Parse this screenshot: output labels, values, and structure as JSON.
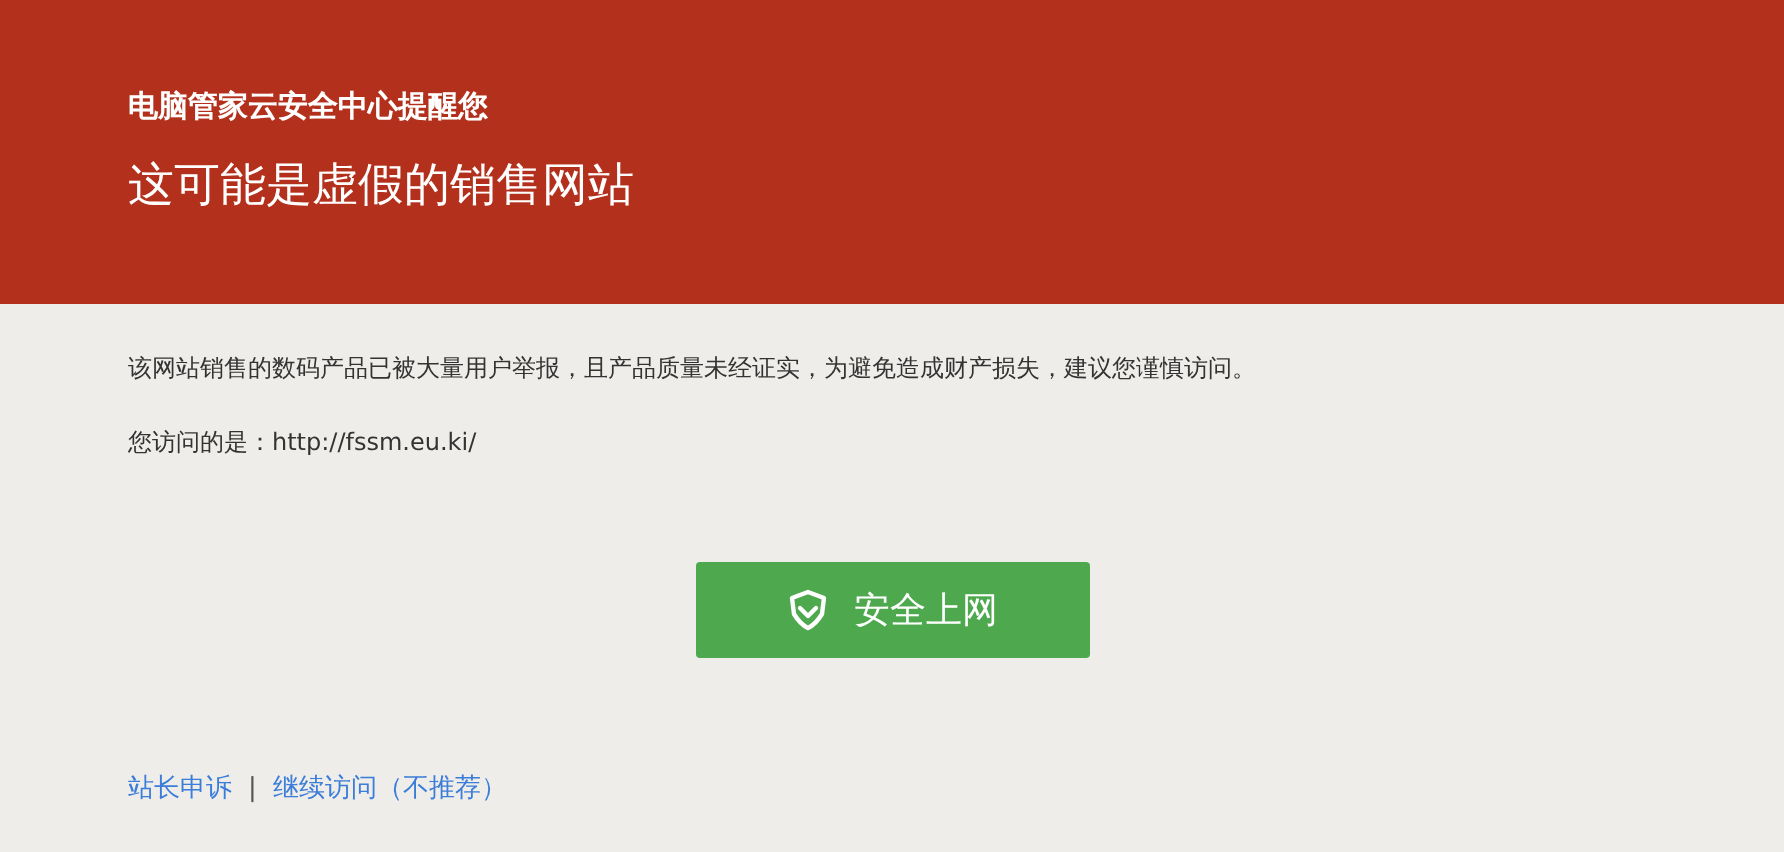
{
  "header": {
    "subtitle": "电脑管家云安全中心提醒您",
    "title": "这可能是虚假的销售网站"
  },
  "body": {
    "message": "该网站销售的数码产品已被大量用户举报，且产品质量未经证实，为避免造成财产损失，建议您谨慎访问。",
    "visited": "您访问的是：http://fssm.eu.ki/"
  },
  "button": {
    "label": "安全上网"
  },
  "footer_links": [
    "站长申诉",
    "继续访问（不推荐）"
  ],
  "separator": "|"
}
